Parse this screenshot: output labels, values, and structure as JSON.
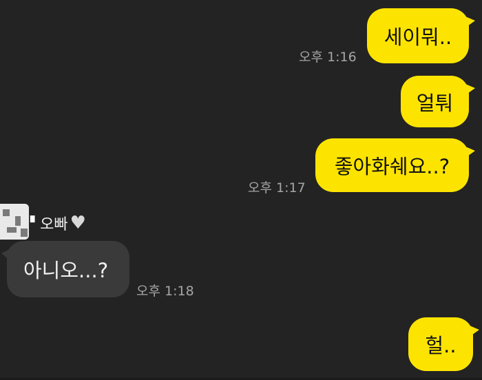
{
  "conversation": {
    "messages": [
      {
        "direction": "outgoing",
        "text": "세이뭐..",
        "time": "오후 1:16"
      },
      {
        "direction": "outgoing",
        "text": "얼퉈",
        "time": ""
      },
      {
        "direction": "outgoing",
        "text": "좋아화쉐요..?",
        "time": "오후 1:17"
      },
      {
        "direction": "incoming",
        "sender": "오빠",
        "text": "아니오...?",
        "time": "오후 1:18"
      },
      {
        "direction": "outgoing",
        "text": "헐..",
        "time": ""
      }
    ]
  },
  "colors": {
    "background": "#232323",
    "outgoing_bubble": "#fde400",
    "incoming_bubble": "#3a3a3a",
    "timestamp": "#a6a6a6"
  },
  "icons": {
    "sender_heart": "heart-icon",
    "sender_avatar": "avatar-icon"
  }
}
